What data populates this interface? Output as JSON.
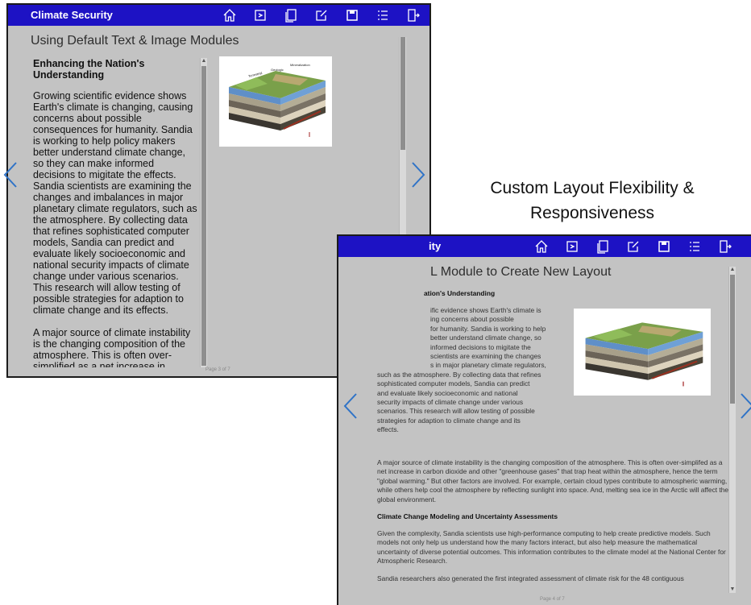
{
  "window1": {
    "app_title": "Climate Security",
    "page_title": "Using Default Text & Image Modules",
    "article_heading": "Enhancing the Nation's Understanding",
    "paragraphs": [
      "Growing scientific evidence shows Earth's climate is changing, causing concerns about possible consequences for humanity. Sandia is working to help policy makers better understand climate change, so they can make informed decisions to migitate the effects. Sandia scientists are examining the changes and imbalances in major planetary climate regulators, such as the atmosphere. By collecting data that refines sophisticated computer models, Sandia can predict and evaluate likely socioeconomic and national security impacts of climate change under various scenarios. This research will allow testing of possible strategies for adaption to climate change and its effects.",
      "A major source of climate instability is the changing composition of the atmosphere. This is often over-simplified as a net increase in"
    ],
    "page_indicator": "Page 3 of 7",
    "toolbar_icons": [
      "home-icon",
      "bookmark-icon",
      "copy-icon",
      "edit-icon",
      "save-icon",
      "list-icon",
      "exit-icon"
    ]
  },
  "window2": {
    "app_title": "ity",
    "page_title": "L Module to Create New Layout",
    "article_heading": "ation's Understanding",
    "intro_lines": [
      "ific evidence shows Earth's climate is",
      "ing concerns about possible",
      "for humanity. Sandia is working to help",
      "better understand climate change, so",
      "informed decisions to migitate the",
      "scientists are examining the changes",
      "s in major planetary climate regulators,",
      "such as the atmosphere. By collecting data that refines",
      "sophisticated computer models, Sandia can predict",
      "and evaluate likely socioeconomic and national",
      "security impacts of climate change under various",
      "scenarios. This research will allow testing of possible",
      "strategies for adaption to climate change and its",
      "effects."
    ],
    "paragraph2": "A major source of climate instability is the changing composition of the atmosphere. This is often over-simplifed as a net increase in carbon dioxide and other \"greenhouse gases\" that trap heat within the atmosphere, hence the term \"global warming.\" But other factors are involved. For example, certain cloud types contribute to atmospheric warming, while others help cool the atmosphere by reflecting sunlight into space. And, melting sea ice in the Arctic will affect the global environment.",
    "subheading": "Climate Change Modeling and Uncertainty Assessments",
    "paragraph3": "Given the complexity, Sandia scientists use high-performance computing to help create predictive models. Such models not only help us understand how the many factors interact, but also help measure the mathematical uncertainty of diverse potential outcomes. This information contributes to the climate model at the National Center for Atmospheric Research.",
    "paragraph4": "Sandia researchers also generated the first integrated assessment of climate risk for the 48 contiguous",
    "page_indicator": "Page 4 of 7"
  },
  "caption": {
    "line1": "Custom Layout Flexibility &",
    "line2": "Responsiveness"
  },
  "image_labels": {
    "a": "Terrestrial",
    "b": "Geologic",
    "c": "Mineralization"
  },
  "colors": {
    "toolbar": "#1d12c4",
    "window_bg": "#c3c3c3",
    "nav_arrow": "#2f73c7"
  }
}
